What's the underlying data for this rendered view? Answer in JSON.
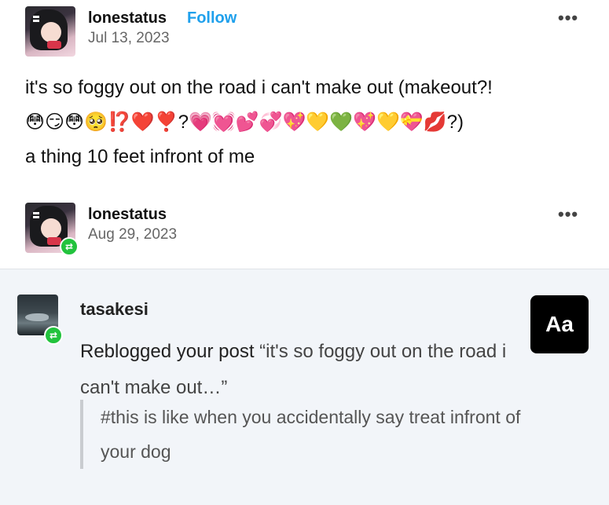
{
  "post": {
    "username": "lonestatus",
    "follow_label": "Follow",
    "date": "Jul 13, 2023",
    "menu_icon": "•••",
    "line1": "it's so foggy out on the road i can't make out (makeout?!",
    "line2": "😳😏😳🥺⁉️❤️❣️?💗💓💕💞💖💛💚💖💛💝💋?)",
    "line3": "a thing 10 feet infront of me"
  },
  "reblog": {
    "username": "lonestatus",
    "date": "Aug 29, 2023",
    "menu_icon": "•••",
    "badge_icon": "⇄"
  },
  "notification": {
    "username": "tasakesi",
    "badge_icon": "⇄",
    "action": "Reblogged your post",
    "quote_title": "“it's so foggy out on the road i can't make out…”",
    "tag_line": "#this is like when you accidentally say treat infront of your dog",
    "aa_label": "Aa"
  },
  "colors": {
    "follow": "#1fa0ec",
    "reblog_badge": "#22c33d",
    "notification_bg": "#f2f5f9"
  }
}
